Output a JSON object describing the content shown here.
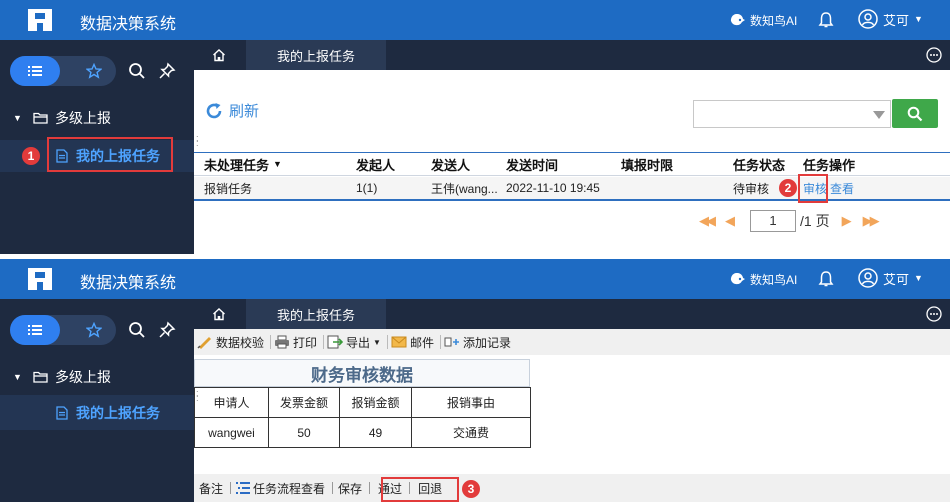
{
  "app": {
    "title": "数据决策系统",
    "ai_label": "数知鸟AI",
    "user_name": "艾可"
  },
  "colors": {
    "topbar": "#1e6bc3",
    "sidebar": "#1e2a40",
    "accent": "#2f7ff0",
    "highlight": "#e23b3b",
    "search_btn": "#3fa84a"
  },
  "sidebar": {
    "tree": [
      {
        "label": "多级上报",
        "children": [
          {
            "label": "我的上报任务",
            "selected": true
          }
        ]
      }
    ]
  },
  "tabs": {
    "active_label": "我的上报任务"
  },
  "panel1": {
    "refresh_label": "刷新",
    "search_value": "",
    "columns": [
      "未处理任务",
      "发起人",
      "发送人",
      "发送时间",
      "填报时限",
      "任务状态",
      "任务操作"
    ],
    "rows": [
      {
        "task": "报销任务",
        "initiator": "1(1)",
        "sender": "王伟(wang...",
        "sent_time": "2022-11-10 19:45",
        "deadline": "",
        "status": "待审核",
        "action_review": "审核",
        "action_view": "查看"
      }
    ],
    "pager": {
      "current_page": "1",
      "total": "/1 页"
    }
  },
  "panel2": {
    "toolbar": [
      "数据校验",
      "打印",
      "导出",
      "邮件",
      "添加记录"
    ],
    "report": {
      "title": "财务审核数据",
      "headers": [
        "申请人",
        "发票金额",
        "报销金额",
        "报销事由"
      ],
      "row": [
        "wangwei",
        "50",
        "49",
        "交通费"
      ]
    },
    "bottom": [
      "备注",
      "任务流程查看",
      "保存",
      "通过",
      "回退"
    ]
  },
  "steps": [
    "1",
    "2",
    "3"
  ]
}
